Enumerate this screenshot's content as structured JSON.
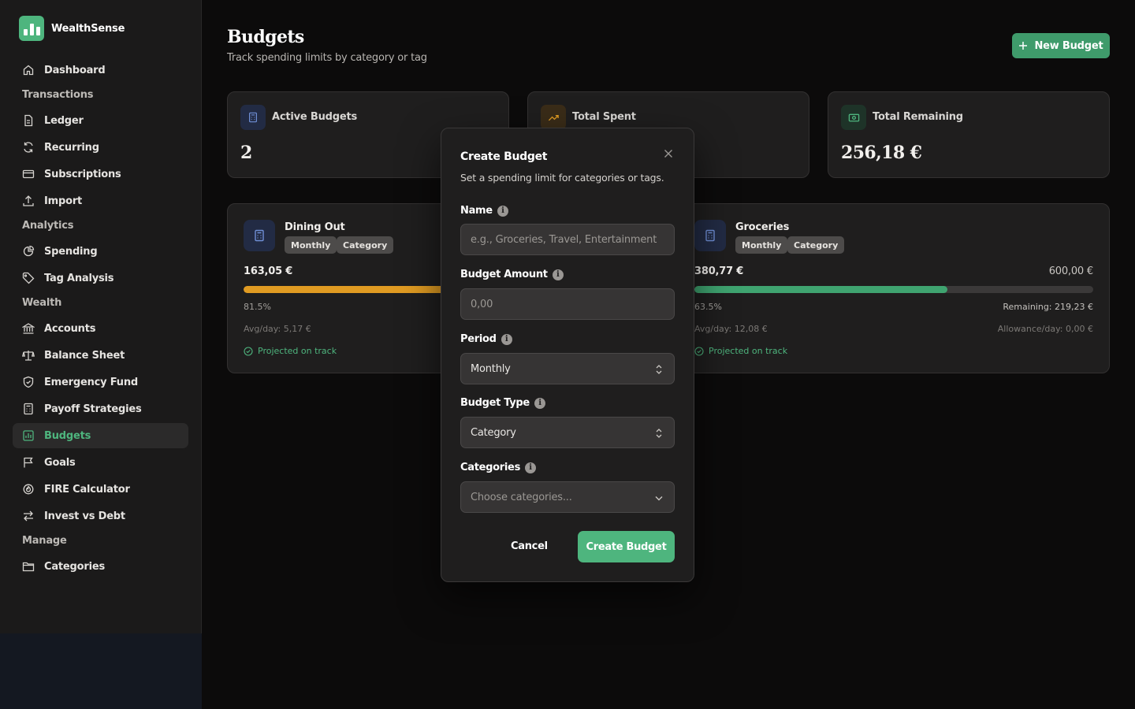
{
  "app": {
    "name": "WealthSense"
  },
  "sidebar": {
    "items": [
      {
        "label": "Dashboard"
      },
      {
        "section": "Transactions"
      },
      {
        "label": "Ledger"
      },
      {
        "label": "Recurring"
      },
      {
        "label": "Subscriptions"
      },
      {
        "label": "Import"
      },
      {
        "section": "Analytics"
      },
      {
        "label": "Spending"
      },
      {
        "label": "Tag Analysis"
      },
      {
        "section": "Wealth"
      },
      {
        "label": "Accounts"
      },
      {
        "label": "Balance Sheet"
      },
      {
        "label": "Emergency Fund"
      },
      {
        "label": "Payoff Strategies"
      },
      {
        "label": "Budgets",
        "active": true
      },
      {
        "label": "Goals"
      },
      {
        "label": "FIRE Calculator"
      },
      {
        "label": "Invest vs Debt"
      },
      {
        "section": "Manage"
      },
      {
        "label": "Categories"
      }
    ]
  },
  "header": {
    "title": "Budgets",
    "subtitle": "Track spending limits by category or tag",
    "new_button": "New Budget"
  },
  "stats": [
    {
      "label": "Active Budgets",
      "value": "2"
    },
    {
      "label": "Total Spent",
      "value": ""
    },
    {
      "label": "Total Remaining",
      "value": "256,18 €"
    }
  ],
  "budgets": [
    {
      "name": "Dining Out",
      "tags": [
        "Monthly",
        "Category"
      ],
      "spent": "163,05 €",
      "limit": "",
      "progress": 0.815,
      "percent": "81.5%",
      "remaining": "",
      "avg_per_day": "Avg/day: 5,17 €",
      "allowance": "",
      "projection": "Projected on track",
      "bar_color": "#e09b22"
    },
    {
      "name": "Groceries",
      "tags": [
        "Monthly",
        "Category"
      ],
      "spent": "380,77 €",
      "limit": "600,00 €",
      "progress": 0.635,
      "percent": "63.5%",
      "remaining": "Remaining: 219,23 €",
      "avg_per_day": "Avg/day: 12,08 €",
      "allowance": "Allowance/day: 0,00 €",
      "projection": "Projected on track",
      "bar_color": "#3fa470"
    }
  ],
  "modal": {
    "title": "Create Budget",
    "description": "Set a spending limit for categories or tags.",
    "fields": {
      "name": {
        "label": "Name",
        "value": "",
        "placeholder": "e.g., Groceries, Travel, Entertainment"
      },
      "amount": {
        "label": "Budget Amount",
        "value": "",
        "placeholder": "0,00"
      },
      "period": {
        "label": "Period",
        "value": "Monthly"
      },
      "type": {
        "label": "Budget Type",
        "value": "Category"
      },
      "categories": {
        "label": "Categories",
        "value": "",
        "placeholder": "Choose categories..."
      }
    },
    "cancel": "Cancel",
    "submit": "Create Budget"
  },
  "colors": {
    "accent": "#4eb57e",
    "warning": "#e09b22",
    "background": "#0c0b0b",
    "card": "#1f1e1e"
  }
}
